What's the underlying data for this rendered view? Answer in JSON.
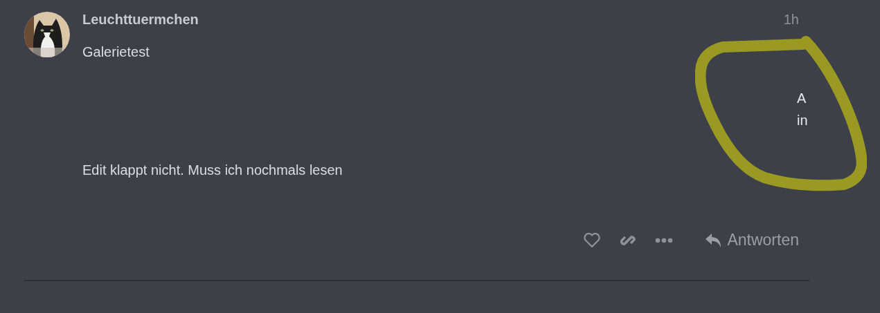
{
  "post": {
    "author": "Leuchttuermchen",
    "time": "1h",
    "paragraphs": [
      "Galerietest",
      "Edit klappt nicht. Muss ich nochmals lesen"
    ],
    "side_text": [
      "A",
      "in"
    ],
    "actions": {
      "reply": "Antworten"
    }
  }
}
